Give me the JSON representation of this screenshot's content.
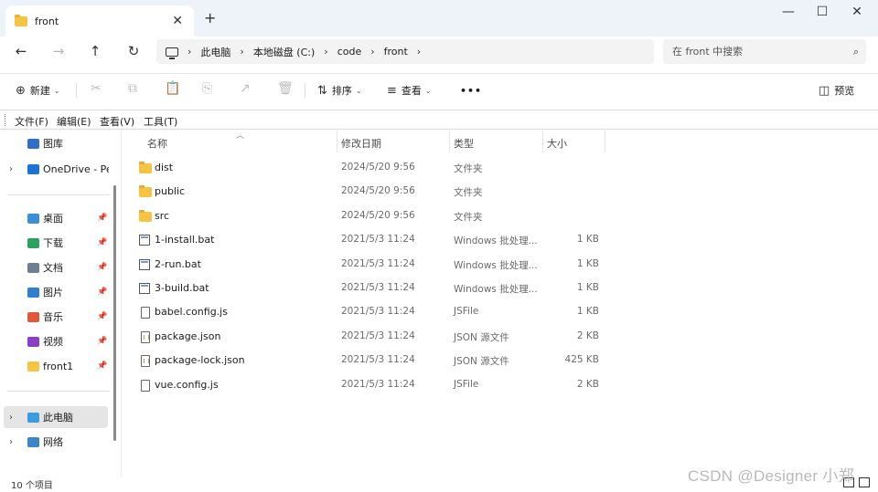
{
  "tab": {
    "title": "front",
    "close": "✕",
    "new_tab": "+"
  },
  "window_controls": {
    "minimize": "—",
    "maximize": "☐",
    "close": "✕"
  },
  "nav_buttons": {
    "back": "←",
    "forward": "→",
    "up": "↑",
    "refresh": "↻"
  },
  "address": {
    "separator": "›",
    "crumbs": [
      "此电脑",
      "本地磁盘 (C:)",
      "code",
      "front"
    ]
  },
  "search": {
    "placeholder": "在 front 中搜索",
    "icon": "⌕"
  },
  "toolbar": {
    "new_label": "新建",
    "new_icon": "⊕",
    "sort_label": "排序",
    "sort_icon": "⇅",
    "view_label": "查看",
    "view_icon": "≡",
    "more": "•••",
    "preview_label": "预览",
    "preview_icon": "◫",
    "disabled_icons": [
      "✂",
      "⧉",
      "📋",
      "⎘",
      "↗",
      "🗑"
    ]
  },
  "menu": [
    "文件(F)",
    "编辑(E)",
    "查看(V)",
    "工具(T)"
  ],
  "nav_pane": {
    "items": [
      {
        "label": "图库",
        "icon": "gallery-icon",
        "color": "#2f6fc7",
        "chevron": false,
        "pinned": false
      },
      {
        "label": "OneDrive - Per",
        "icon": "cloud-icon",
        "color": "#1a73d9",
        "chevron": true,
        "pinned": false
      },
      {
        "label": "桌面",
        "icon": "desktop-icon",
        "color": "#3b8fd8",
        "chevron": false,
        "pinned": true
      },
      {
        "label": "下载",
        "icon": "download-icon",
        "color": "#2aa260",
        "chevron": false,
        "pinned": true
      },
      {
        "label": "文档",
        "icon": "document-icon",
        "color": "#6f7f90",
        "chevron": false,
        "pinned": true
      },
      {
        "label": "图片",
        "icon": "pictures-icon",
        "color": "#2f7fd0",
        "chevron": false,
        "pinned": true
      },
      {
        "label": "音乐",
        "icon": "music-icon",
        "color": "#e0593a",
        "chevron": false,
        "pinned": true
      },
      {
        "label": "视频",
        "icon": "video-icon",
        "color": "#8a3fc9",
        "chevron": false,
        "pinned": true
      },
      {
        "label": "front1",
        "icon": "folder-icon",
        "color": "#f5c443",
        "chevron": false,
        "pinned": true
      },
      {
        "label": "此电脑",
        "icon": "computer-icon",
        "color": "#3a9be0",
        "chevron": true,
        "pinned": false,
        "selected": true
      },
      {
        "label": "网络",
        "icon": "network-icon",
        "color": "#3a86c9",
        "chevron": true,
        "pinned": false
      }
    ],
    "pin_glyph": "📌",
    "chevron_glyph": "›"
  },
  "columns": {
    "name": "名称",
    "modified": "修改日期",
    "type": "类型",
    "size": "大小"
  },
  "files": [
    {
      "name": "dist",
      "modified": "2024/5/20 9:56",
      "type": "文件夹",
      "size": "",
      "kind": "folder"
    },
    {
      "name": "public",
      "modified": "2024/5/20 9:56",
      "type": "文件夹",
      "size": "",
      "kind": "folder"
    },
    {
      "name": "src",
      "modified": "2024/5/20 9:56",
      "type": "文件夹",
      "size": "",
      "kind": "folder"
    },
    {
      "name": "1-install.bat",
      "modified": "2021/5/3 11:24",
      "type": "Windows 批处理...",
      "size": "1 KB",
      "kind": "bat"
    },
    {
      "name": "2-run.bat",
      "modified": "2021/5/3 11:24",
      "type": "Windows 批处理...",
      "size": "1 KB",
      "kind": "bat"
    },
    {
      "name": "3-build.bat",
      "modified": "2021/5/3 11:24",
      "type": "Windows 批处理...",
      "size": "1 KB",
      "kind": "bat"
    },
    {
      "name": "babel.config.js",
      "modified": "2021/5/3 11:24",
      "type": "JSFile",
      "size": "1 KB",
      "kind": "doc"
    },
    {
      "name": "package.json",
      "modified": "2021/5/3 11:24",
      "type": "JSON 源文件",
      "size": "2 KB",
      "kind": "json"
    },
    {
      "name": "package-lock.json",
      "modified": "2021/5/3 11:24",
      "type": "JSON 源文件",
      "size": "425 KB",
      "kind": "json"
    },
    {
      "name": "vue.config.js",
      "modified": "2021/5/3 11:24",
      "type": "JSFile",
      "size": "2 KB",
      "kind": "doc"
    }
  ],
  "status": {
    "count": "10 个项目"
  },
  "watermark": "CSDN @Designer 小郑"
}
